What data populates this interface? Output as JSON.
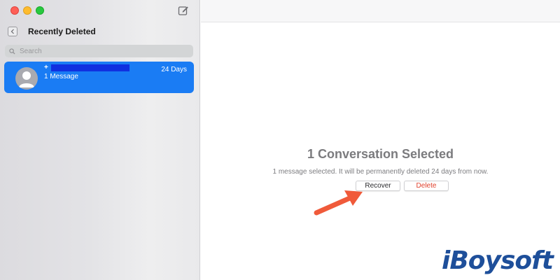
{
  "sidebar": {
    "title": "Recently Deleted",
    "search_placeholder": "Search",
    "conversation": {
      "name_prefix": "+",
      "days": "24 Days",
      "subtitle": "1 Message"
    }
  },
  "main": {
    "title": "1 Conversation Selected",
    "subtitle": "1 message selected. It will be permanently deleted 24 days from now.",
    "recover_label": "Recover",
    "delete_label": "Delete"
  },
  "logo": {
    "text": "iBoysoft"
  },
  "colors": {
    "accent": "#1a7cf4",
    "delete_text": "#e0402c",
    "annotation_arrow": "#f05a3a",
    "logo": "#1e4f9a"
  },
  "icons": {
    "compose": "compose-icon",
    "back": "chevron-left-icon",
    "search": "search-icon",
    "avatar": "person-icon",
    "arrow": "arrow-annotation-icon"
  }
}
